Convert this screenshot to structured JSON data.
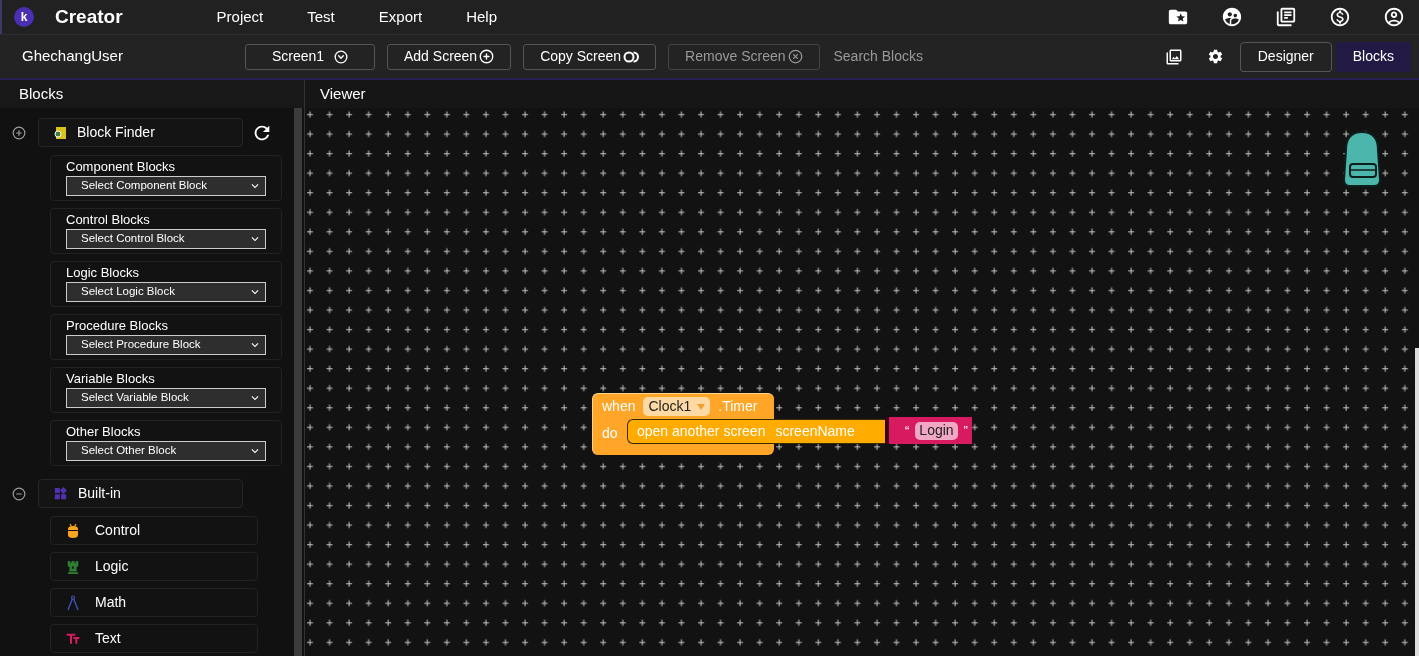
{
  "app": {
    "logo_letter": "k",
    "title": "Creator",
    "menu": [
      "Project",
      "Test",
      "Export",
      "Help"
    ]
  },
  "toolbar": {
    "project_name": "GhechangUser",
    "screen_selector": "Screen1",
    "buttons": [
      {
        "label": "Add Screen",
        "kind": "add",
        "disabled": false
      },
      {
        "label": "Copy Screen",
        "kind": "copy",
        "disabled": false
      },
      {
        "label": "Remove Screen",
        "kind": "remove",
        "disabled": true
      }
    ],
    "search": {
      "placeholder": "Search Blocks"
    },
    "view_tabs": [
      {
        "label": "Designer",
        "selected": false
      },
      {
        "label": "Blocks",
        "selected": true
      }
    ]
  },
  "sidebar": {
    "title": "Blocks",
    "groups": [
      {
        "label": "Block Finder",
        "kind": "finder",
        "expanded": false,
        "categories": [
          {
            "title": "Component Blocks",
            "select": "Select Component Block"
          },
          {
            "title": "Control Blocks",
            "select": "Select Control Block"
          },
          {
            "title": "Logic Blocks",
            "select": "Select Logic Block"
          },
          {
            "title": "Procedure Blocks",
            "select": "Select Procedure Block"
          },
          {
            "title": "Variable Blocks",
            "select": "Select Variable Block"
          },
          {
            "title": "Other Blocks",
            "select": "Select Other Block"
          }
        ]
      },
      {
        "label": "Built-in",
        "kind": "builtin",
        "expanded": true,
        "items": [
          {
            "label": "Control",
            "kind": "control",
            "color": "#f5a623"
          },
          {
            "label": "Logic",
            "kind": "logic",
            "color": "#2e7d32"
          },
          {
            "label": "Math",
            "kind": "math",
            "color": "#3f51b5"
          },
          {
            "label": "Text",
            "kind": "text",
            "color": "#d81b60"
          }
        ]
      }
    ]
  },
  "viewer": {
    "title": "Viewer",
    "event_block": {
      "when": "when",
      "component": "Clock1",
      "event": ".Timer",
      "do": "do",
      "call": {
        "label": "open another screen",
        "param": "screenName",
        "text_block": {
          "open_quote": "“",
          "value": "Login",
          "close_quote": "”"
        }
      }
    }
  }
}
